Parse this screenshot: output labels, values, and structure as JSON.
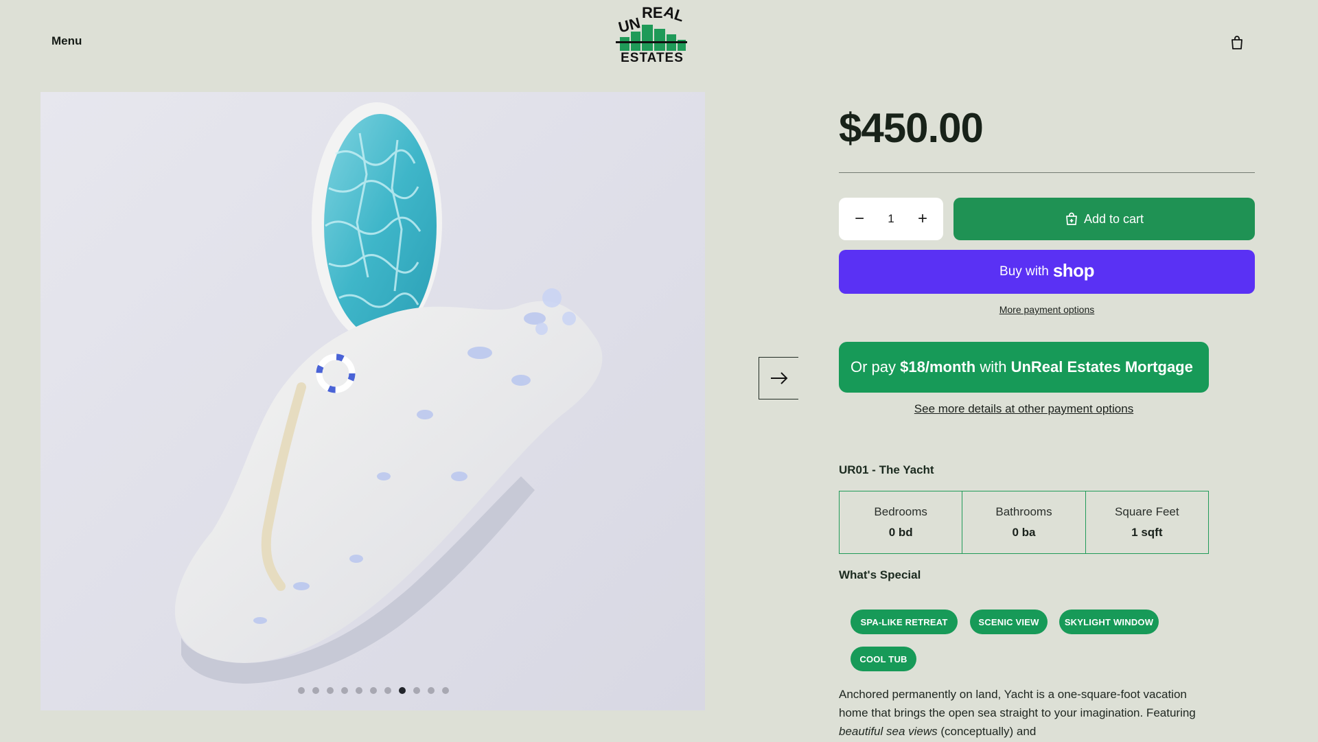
{
  "header": {
    "menu_label": "Menu",
    "logo_line1": "UNREAL",
    "logo_line2": "ESTATES",
    "cart_icon": "shopping-bag-icon"
  },
  "gallery": {
    "dot_count": 11,
    "active_dot_index": 7,
    "next_icon": "arrow-right-icon"
  },
  "product": {
    "price": "$450.00",
    "quantity": "1",
    "qty_minus": "−",
    "qty_plus": "+",
    "add_to_cart": "Add to cart",
    "buy_with": "Buy with",
    "shop_word": "shop",
    "more_payment": "More payment options",
    "mortgage_prefix": "Or pay",
    "mortgage_amount": "$18/month",
    "mortgage_mid": "with",
    "mortgage_brand": "UnReal Estates Mortgage",
    "see_more": "See more details at other payment options",
    "title": "UR01 - The Yacht",
    "specs": [
      {
        "label": "Bedrooms",
        "value": "0 bd"
      },
      {
        "label": "Bathrooms",
        "value": "0 ba"
      },
      {
        "label": "Square Feet",
        "value": "1 sqft"
      }
    ],
    "special_title": "What's Special",
    "tags": [
      "SPA-LIKE RETREAT",
      "SCENIC VIEW",
      "SKYLIGHT WINDOW",
      "COOL TUB"
    ],
    "description_part1": "Anchored permanently on land, Yacht is a one-square-foot vacation home that brings the open sea straight to your imagination. Featuring ",
    "description_em": "beautiful sea views",
    "description_part2": " (conceptually) and"
  },
  "colors": {
    "background": "#dde0d6",
    "brand_green": "#1f9254",
    "shop_purple": "#5a31f4"
  }
}
